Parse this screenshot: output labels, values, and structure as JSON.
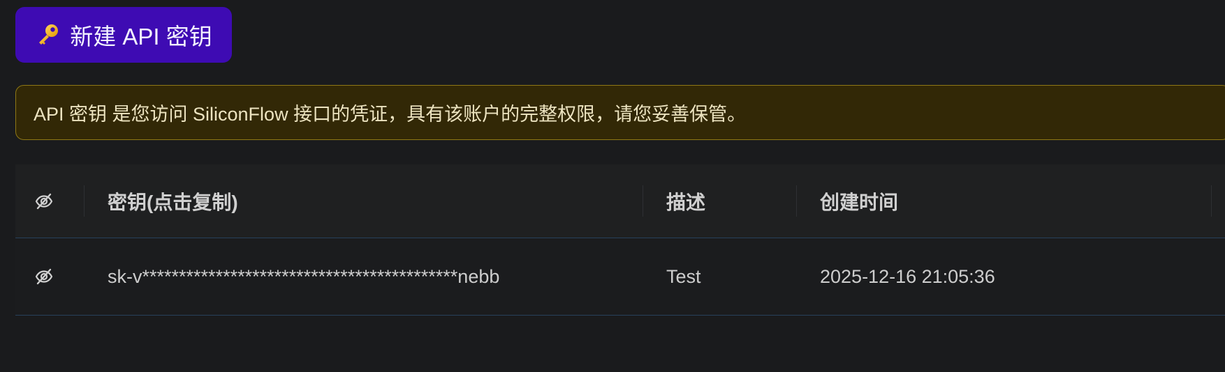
{
  "toolbar": {
    "new_key_label": "新建 API 密钥",
    "new_key_icon": "key-icon"
  },
  "notice": {
    "text": "API 密钥 是您访问 SiliconFlow 接口的凭证，具有该账户的完整权限，请您妥善保管。"
  },
  "table": {
    "header_icon": "eye-slash-icon",
    "columns": [
      "密钥(点击复制)",
      "描述",
      "创建时间"
    ],
    "rows": [
      {
        "icon": "eye-slash-icon",
        "key": "sk-v*******************************************nebb",
        "description": "Test",
        "created_at": "2025-12-16 21:05:36"
      }
    ]
  },
  "colors": {
    "background": "#1a1b1d",
    "primary_button": "#3e0bb3",
    "notice_background": "#322806",
    "notice_border": "#8f7815",
    "table_line": "#27415b"
  }
}
